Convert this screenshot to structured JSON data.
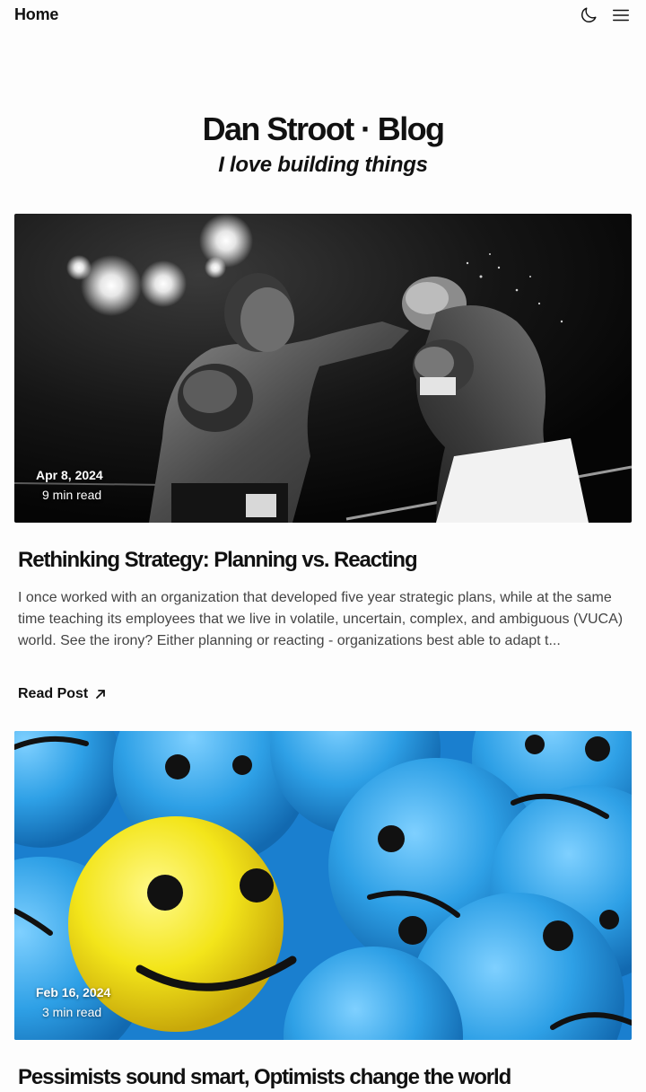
{
  "nav": {
    "home_label": "Home",
    "theme_icon": "moon-icon",
    "menu_icon": "hamburger-menu-icon"
  },
  "site": {
    "title": "Dan Stroot · Blog",
    "tagline": "I love building things"
  },
  "posts": [
    {
      "date": "Apr 8, 2024",
      "read_time": "9 min read",
      "title": "Rethinking Strategy: Planning vs. Reacting",
      "excerpt": "I once worked with an organization that developed five year strategic plans, while at the same time teaching its employees that we live in volatile, uncertain, complex, and ambiguous (VUCA) world. See the irony? Either planning or reacting - organizations best able to adapt t...",
      "link_label": "Read Post",
      "cover_icon": "boxing-photo"
    },
    {
      "date": "Feb 16, 2024",
      "read_time": "3 min read",
      "title": "Pessimists sound smart, Optimists change the world",
      "cover_icon": "smiley-faces-photo"
    }
  ],
  "colors": {
    "text": "#111111",
    "muted": "#444444",
    "background": "#fdfdfd",
    "smiley_blue": "#3aa6e8",
    "smiley_yellow": "#f5e21a"
  }
}
